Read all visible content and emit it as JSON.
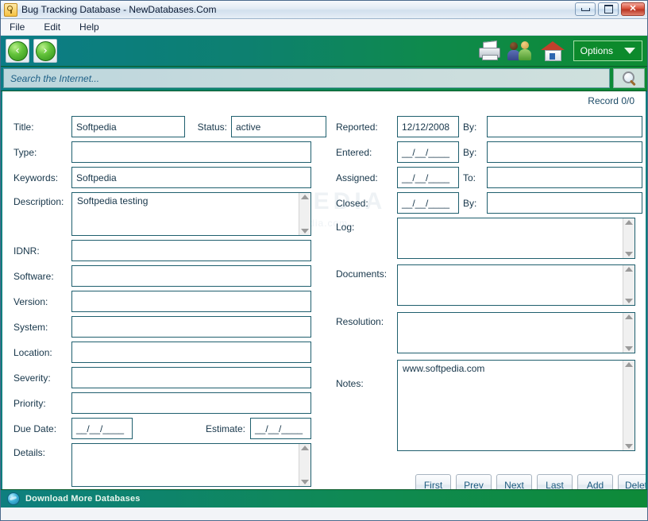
{
  "window": {
    "title": "Bug Tracking Database - NewDatabases.Com",
    "app_icon": "key-icon",
    "buttons": {
      "minimize": "minimize-icon",
      "maximize": "maximize-icon",
      "close": "✕"
    }
  },
  "menubar": {
    "items": [
      "File",
      "Edit",
      "Help"
    ]
  },
  "toolbar": {
    "back": "‹",
    "forward": "›",
    "icons": [
      "printer-icon",
      "users-icon",
      "home-icon"
    ],
    "options_label": "Options"
  },
  "search": {
    "placeholder": "Search the Internet...",
    "value": "",
    "go_icon": "magnifier-icon"
  },
  "record": {
    "label": "Record 0/0"
  },
  "watermark": {
    "big": "SOFTPEDIA",
    "small": "www.softpedia.com"
  },
  "form": {
    "left": [
      {
        "label": "Title:",
        "value": "Softpedia",
        "type": "text"
      },
      {
        "label": "Status:",
        "value": "active",
        "type": "text"
      },
      {
        "label": "Type:",
        "value": "",
        "type": "text"
      },
      {
        "label": "Keywords:",
        "value": "Softpedia",
        "type": "text"
      },
      {
        "label": "Description:",
        "value": "Softpedia testing",
        "type": "area"
      },
      {
        "label": "IDNR:",
        "value": "",
        "type": "text"
      },
      {
        "label": "Software:",
        "value": "",
        "type": "text"
      },
      {
        "label": "Version:",
        "value": "",
        "type": "text"
      },
      {
        "label": "System:",
        "value": "",
        "type": "text"
      },
      {
        "label": "Location:",
        "value": "",
        "type": "text"
      },
      {
        "label": "Severity:",
        "value": "",
        "type": "text"
      },
      {
        "label": "Priority:",
        "value": "",
        "type": "text"
      },
      {
        "label": "Due Date:",
        "value": "__/__/____",
        "type": "date"
      },
      {
        "label": "Estimate:",
        "value": "__/__/____",
        "type": "date"
      },
      {
        "label": "Details:",
        "value": "",
        "type": "area"
      }
    ],
    "right": [
      {
        "label": "Reported:",
        "value": "12/12/2008",
        "type": "date"
      },
      {
        "label": "By:",
        "value": "",
        "type": "text"
      },
      {
        "label": "Entered:",
        "value": "__/__/____",
        "type": "date"
      },
      {
        "label": "By:",
        "value": "",
        "type": "text"
      },
      {
        "label": "Assigned:",
        "value": "__/__/____",
        "type": "date"
      },
      {
        "label": "To:",
        "value": "",
        "type": "text"
      },
      {
        "label": "Closed:",
        "value": "__/__/____",
        "type": "date"
      },
      {
        "label": "By:",
        "value": "",
        "type": "text"
      },
      {
        "label": "Log:",
        "value": "",
        "type": "area"
      },
      {
        "label": "Documents:",
        "value": "",
        "type": "area"
      },
      {
        "label": "Resolution:",
        "value": "",
        "type": "area"
      },
      {
        "label": "Notes:",
        "value": "www.softpedia.com",
        "type": "area"
      }
    ]
  },
  "navigation": {
    "buttons": [
      "First",
      "Prev",
      "Next",
      "Last",
      "Add",
      "Delete"
    ]
  },
  "statusbar": {
    "icon": "globe-icon",
    "text": "Download More Databases"
  },
  "colors": {
    "toolbar_start": "#0b7c87",
    "toolbar_end": "#0d8b33",
    "field_border": "#1f5f6e",
    "label_text": "#17364a",
    "button_text": "#1d5b80"
  }
}
